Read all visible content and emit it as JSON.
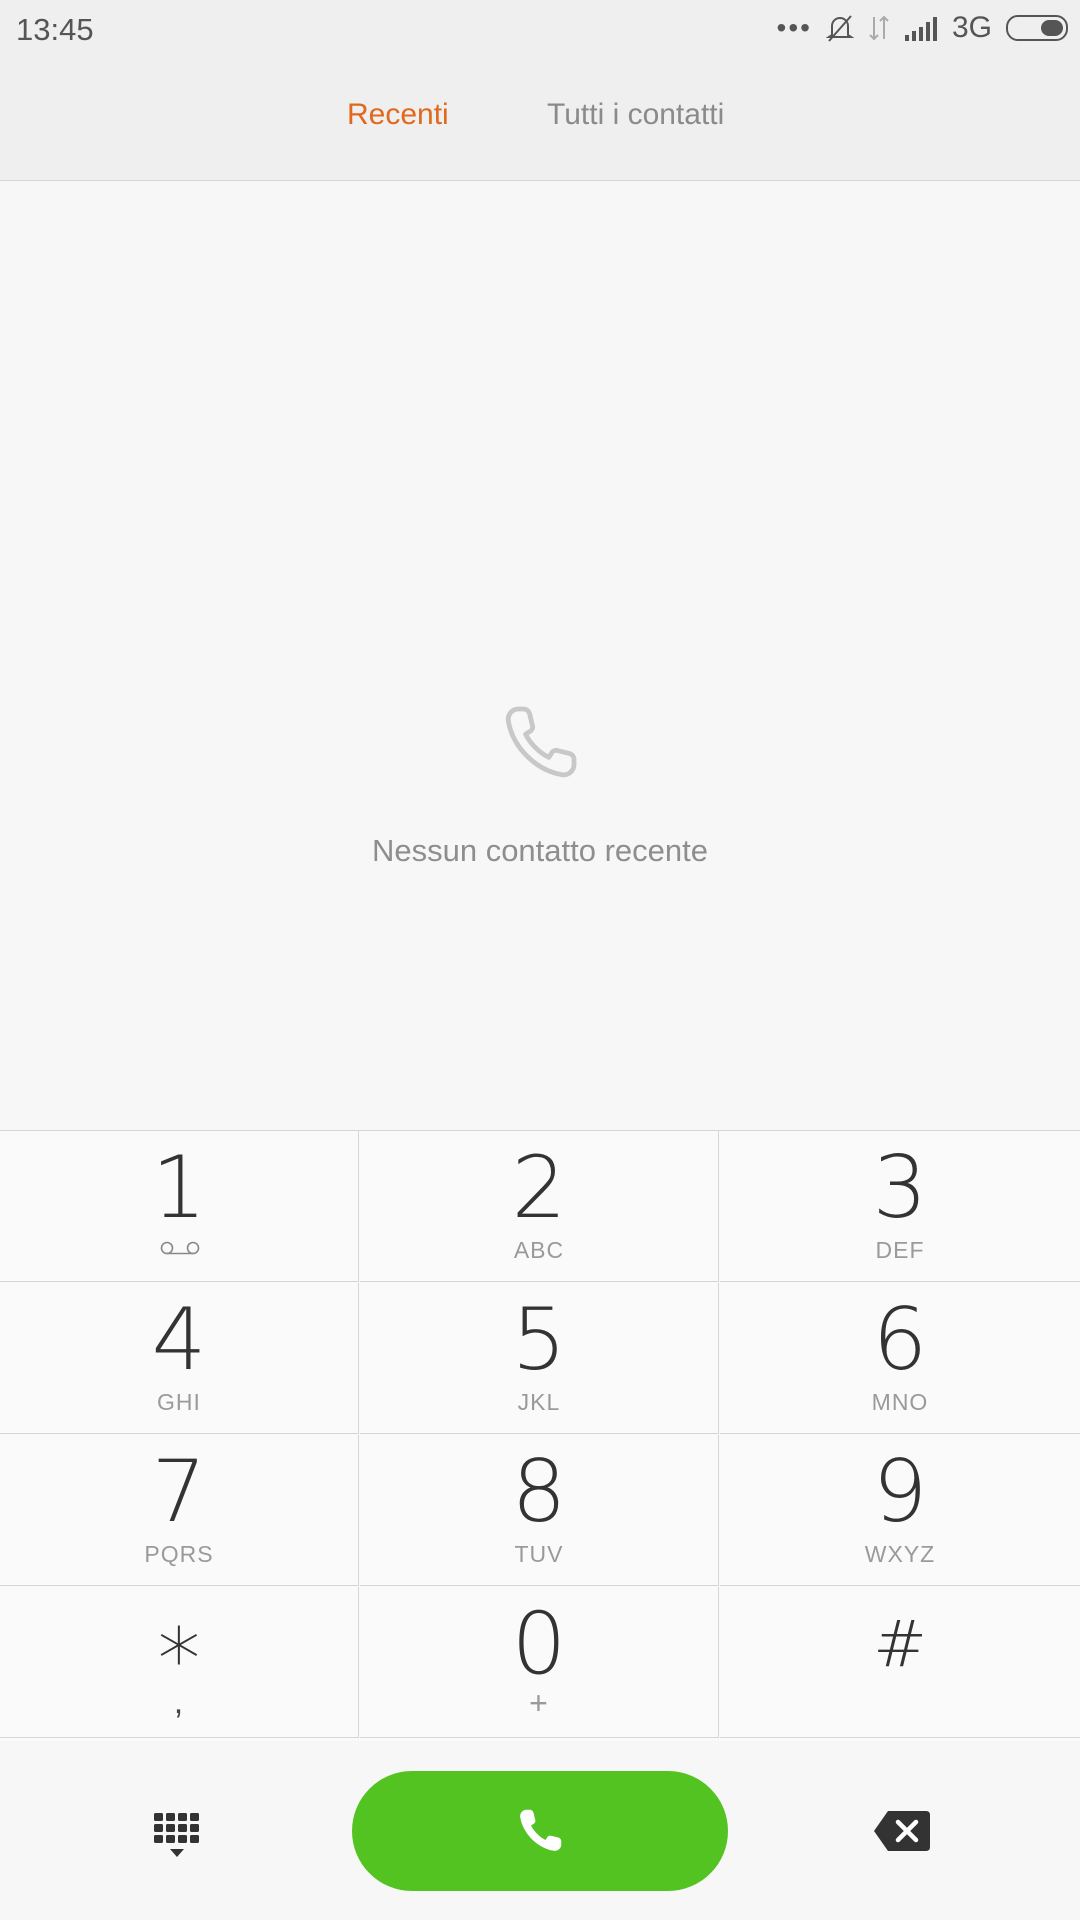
{
  "status_bar": {
    "time": "13:45",
    "network": "3G",
    "icons": [
      "more-dots-icon",
      "bell-muted-icon",
      "data-arrows-icon",
      "signal-icon",
      "battery-icon"
    ]
  },
  "tabs": [
    {
      "label": "Recenti",
      "active": true
    },
    {
      "label": "Tutti i contatti",
      "active": false
    }
  ],
  "empty_state": {
    "icon": "phone-outline-icon",
    "text": "Nessun contatto recente"
  },
  "keypad": {
    "keys": [
      {
        "digit": "1",
        "letters": "",
        "icon": "voicemail-icon"
      },
      {
        "digit": "2",
        "letters": "ABC"
      },
      {
        "digit": "3",
        "letters": "DEF"
      },
      {
        "digit": "4",
        "letters": "GHI"
      },
      {
        "digit": "5",
        "letters": "JKL"
      },
      {
        "digit": "6",
        "letters": "MNO"
      },
      {
        "digit": "7",
        "letters": "PQRS"
      },
      {
        "digit": "8",
        "letters": "TUV"
      },
      {
        "digit": "9",
        "letters": "WXYZ"
      },
      {
        "digit": "*",
        "letters": ","
      },
      {
        "digit": "0",
        "letters": "+"
      },
      {
        "digit": "#",
        "letters": ""
      }
    ]
  },
  "bottom_bar": {
    "dialpad_icon": "dialpad-grid-icon",
    "call_icon": "phone-icon",
    "delete_icon": "backspace-icon",
    "call_color": "#53c322",
    "accent": "#e0691d"
  }
}
